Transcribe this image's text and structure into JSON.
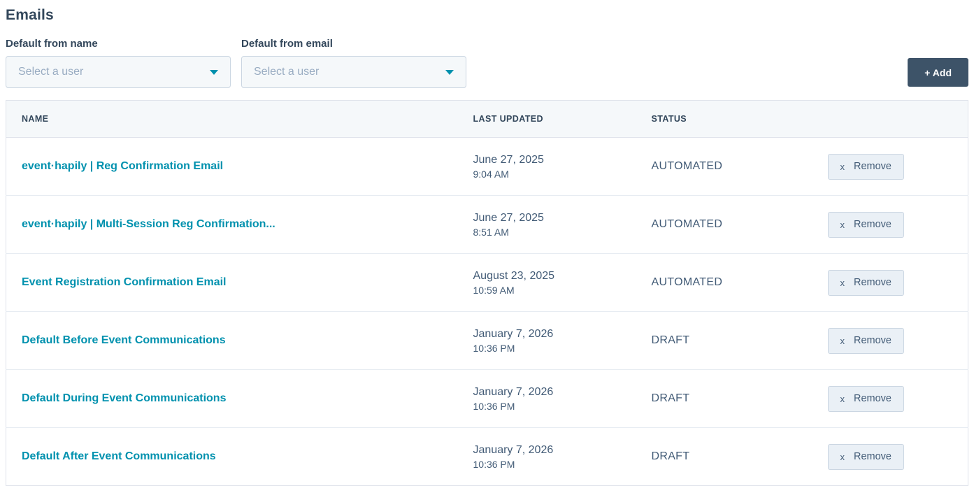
{
  "page": {
    "title": "Emails"
  },
  "filters": {
    "from_name": {
      "label": "Default from name",
      "placeholder": "Select a user"
    },
    "from_email": {
      "label": "Default from email",
      "placeholder": "Select a user"
    }
  },
  "add_button": {
    "label": "+ Add"
  },
  "table": {
    "columns": {
      "name": "NAME",
      "updated": "LAST UPDATED",
      "status": "STATUS"
    },
    "remove_icon": "x",
    "remove_label": "Remove",
    "rows": [
      {
        "name": "event·hapily | Reg Confirmation Email",
        "date": "June 27, 2025",
        "time": "9:04 AM",
        "status": "AUTOMATED"
      },
      {
        "name": "event·hapily | Multi-Session Reg Confirmation...",
        "date": "June 27, 2025",
        "time": "8:51 AM",
        "status": "AUTOMATED"
      },
      {
        "name": "Event Registration Confirmation Email",
        "date": "August 23, 2025",
        "time": "10:59 AM",
        "status": "AUTOMATED"
      },
      {
        "name": "Default Before Event Communications",
        "date": "January 7, 2026",
        "time": "10:36 PM",
        "status": "DRAFT"
      },
      {
        "name": "Default During Event Communications",
        "date": "January 7, 2026",
        "time": "10:36 PM",
        "status": "DRAFT"
      },
      {
        "name": "Default After Event Communications",
        "date": "January 7, 2026",
        "time": "10:36 PM",
        "status": "DRAFT"
      }
    ]
  },
  "colors": {
    "link_teal": "#0091ae",
    "caret_teal": "#0091ae",
    "navy_text": "#33475b",
    "secondary_text": "#425b76",
    "dark_button_bg": "#3d5368",
    "table_header_bg": "#f5f8fa",
    "input_bg": "#f5f8fa",
    "border": "#cbd6e2"
  }
}
